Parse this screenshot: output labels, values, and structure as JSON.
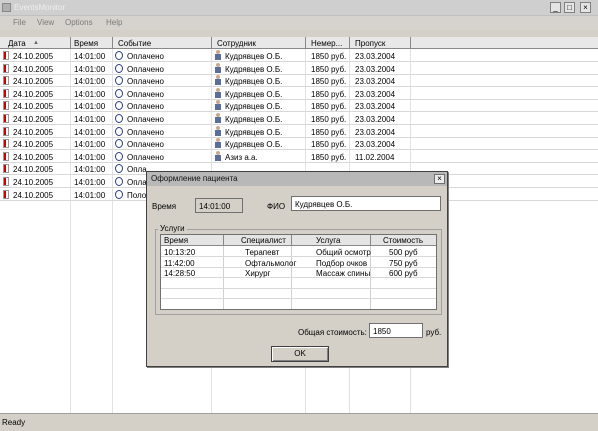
{
  "window": {
    "title": "EventsMonitor",
    "minimize": "_",
    "maximize": "□",
    "close": "×"
  },
  "menu": [
    "File",
    "View",
    "Options",
    "Help"
  ],
  "grid": {
    "columns": [
      "Дата",
      "Время",
      "Событие",
      "Сотрудник",
      "Немер...",
      "Пропуск"
    ],
    "sort_indicator": "▲",
    "rows": [
      {
        "date": "24.10.2005",
        "time": "14:01:00",
        "event": "Оплачено",
        "employee": "Кудрявцев О.Б.",
        "amount": "1850 руб.",
        "pass": "23.03.2004"
      },
      {
        "date": "24.10.2005",
        "time": "14:01:00",
        "event": "Оплачено",
        "employee": "Кудрявцев О.Б.",
        "amount": "1850 руб.",
        "pass": "23.03.2004"
      },
      {
        "date": "24.10.2005",
        "time": "14:01:00",
        "event": "Оплачено",
        "employee": "Кудрявцев О.Б.",
        "amount": "1850 руб.",
        "pass": "23.03.2004"
      },
      {
        "date": "24.10.2005",
        "time": "14:01:00",
        "event": "Оплачено",
        "employee": "Кудрявцев О.Б.",
        "amount": "1850 руб.",
        "pass": "23.03.2004"
      },
      {
        "date": "24.10.2005",
        "time": "14:01:00",
        "event": "Оплачено",
        "employee": "Кудрявцев О.Б.",
        "amount": "1850 руб.",
        "pass": "23.03.2004"
      },
      {
        "date": "24.10.2005",
        "time": "14:01:00",
        "event": "Оплачено",
        "employee": "Кудрявцев О.Б.",
        "amount": "1850 руб.",
        "pass": "23.03.2004"
      },
      {
        "date": "24.10.2005",
        "time": "14:01:00",
        "event": "Оплачено",
        "employee": "Кудрявцев О.Б.",
        "amount": "1850 руб.",
        "pass": "23.03.2004"
      },
      {
        "date": "24.10.2005",
        "time": "14:01:00",
        "event": "Оплачено",
        "employee": "Кудрявцев О.Б.",
        "amount": "1850 руб.",
        "pass": "23.03.2004"
      },
      {
        "date": "24.10.2005",
        "time": "14:01:00",
        "event": "Оплачено",
        "employee": "Азиз а.а.",
        "amount": "1850 руб.",
        "pass": "11.02.2004"
      },
      {
        "date": "24.10.2005",
        "time": "14:01:00",
        "event": "Опла",
        "employee": "",
        "amount": "",
        "pass": ""
      },
      {
        "date": "24.10.2005",
        "time": "14:01:00",
        "event": "Опла",
        "employee": "",
        "amount": "",
        "pass": ""
      },
      {
        "date": "24.10.2005",
        "time": "14:01:00",
        "event": "Поло",
        "employee": "",
        "amount": "",
        "pass": ""
      }
    ]
  },
  "dialog": {
    "title": "Оформление пациента",
    "close": "×",
    "time_label": "Время",
    "time_value": "14:01:00",
    "fio_label": "ФИО",
    "fio_value": "Кудрявцев О.Б.",
    "services_label": "Услуги",
    "services_columns": [
      "Время",
      "Специалист",
      "Услуга",
      "Стоимость"
    ],
    "services": [
      {
        "time": "10:13:20",
        "specialist": "Терапевт",
        "service": "Общий осмотр",
        "cost": "500 руб"
      },
      {
        "time": "11:42:00",
        "specialist": "Офтальмолог",
        "service": "Подбор очков",
        "cost": "750 руб"
      },
      {
        "time": "14:28:50",
        "specialist": "Хирург",
        "service": "Массаж спины",
        "cost": "600 руб"
      }
    ],
    "total_label": "Общая стоимость:",
    "total_value": "1850",
    "total_unit": "руб.",
    "ok_label": "OK"
  },
  "status": {
    "text": "Ready"
  }
}
